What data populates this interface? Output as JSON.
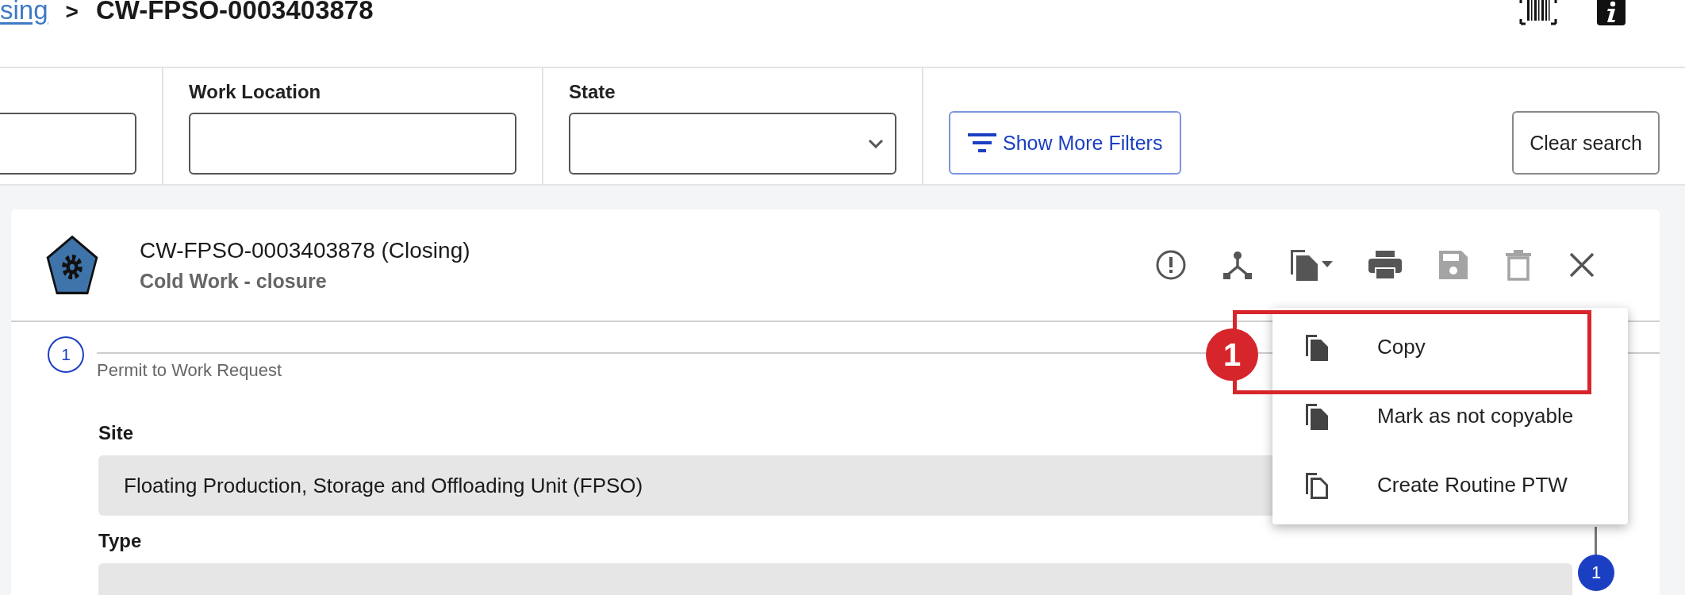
{
  "breadcrumb": {
    "parent_link": "sing",
    "separator": ">",
    "current": "CW-FPSO-0003403878"
  },
  "filters": [
    {
      "kind": "text"
    },
    {
      "kind": "text",
      "label": "Work Location"
    },
    {
      "kind": "select",
      "label": "State"
    }
  ],
  "show_more_filters": "Show More Filters",
  "clear_search": "Clear search",
  "record": {
    "title": "CW-FPSO-0003403878 (Closing)",
    "subtitle": "Cold Work - closure"
  },
  "toolbar": [
    {
      "kind": "alert",
      "disabled": false
    },
    {
      "kind": "split",
      "disabled": false
    },
    {
      "kind": "copy",
      "disabled": false
    },
    {
      "kind": "print",
      "disabled": false
    },
    {
      "kind": "save",
      "disabled": true
    },
    {
      "kind": "delete",
      "disabled": true
    },
    {
      "kind": "close",
      "disabled": false
    }
  ],
  "stepper": {
    "number": "1",
    "label": "Permit to Work Request"
  },
  "fields": [
    {
      "label": "Site",
      "value": "Floating Production, Storage and Offloading Unit (FPSO)"
    },
    {
      "label": "Type"
    }
  ],
  "copy_menu": [
    {
      "label": "Copy",
      "kind": "filled"
    },
    {
      "label": "Mark as not copyable",
      "kind": "filled"
    },
    {
      "label": "Create Routine PTW",
      "kind": "outline"
    }
  ],
  "annotation": {
    "number": "1"
  },
  "side_step": {
    "number": "1"
  }
}
